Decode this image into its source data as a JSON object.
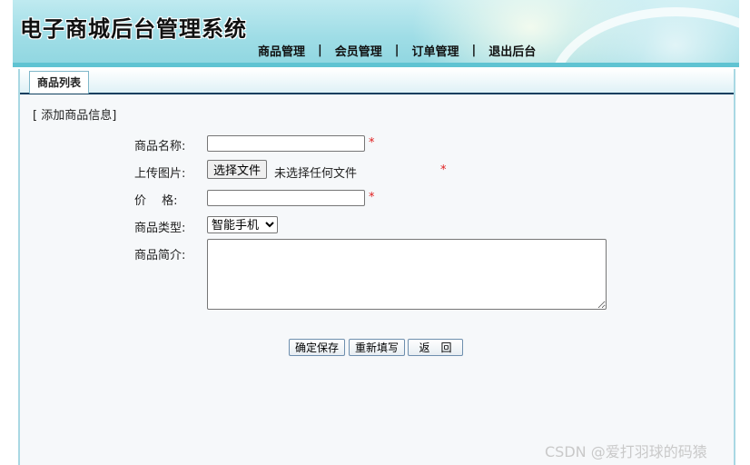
{
  "header": {
    "title": "电子商城后台管理系统",
    "nav": [
      {
        "label": "商品管理"
      },
      {
        "label": "会员管理"
      },
      {
        "label": "订单管理"
      },
      {
        "label": "退出后台"
      }
    ],
    "separator": "|"
  },
  "tabs": [
    {
      "label": "商品列表"
    }
  ],
  "form": {
    "section_title": "[ 添加商品信息]",
    "name_label": "商品名称:",
    "name_value": "",
    "image_label": "上传图片:",
    "file_button": "选择文件",
    "file_status": "未选择任何文件",
    "price_label": "价　 格:",
    "price_value": "",
    "type_label": "商品类型:",
    "type_selected": "智能手机",
    "intro_label": "商品简介:",
    "intro_value": "",
    "required_mark": "*"
  },
  "buttons": {
    "save": "确定保存",
    "reset": "重新填写",
    "back": "返　回"
  },
  "watermark": "CSDN @爱打羽球的码猿",
  "colors": {
    "header_bg": "#9fdde6",
    "tab_underline": "#0d3e5e",
    "required": "#e02020"
  }
}
